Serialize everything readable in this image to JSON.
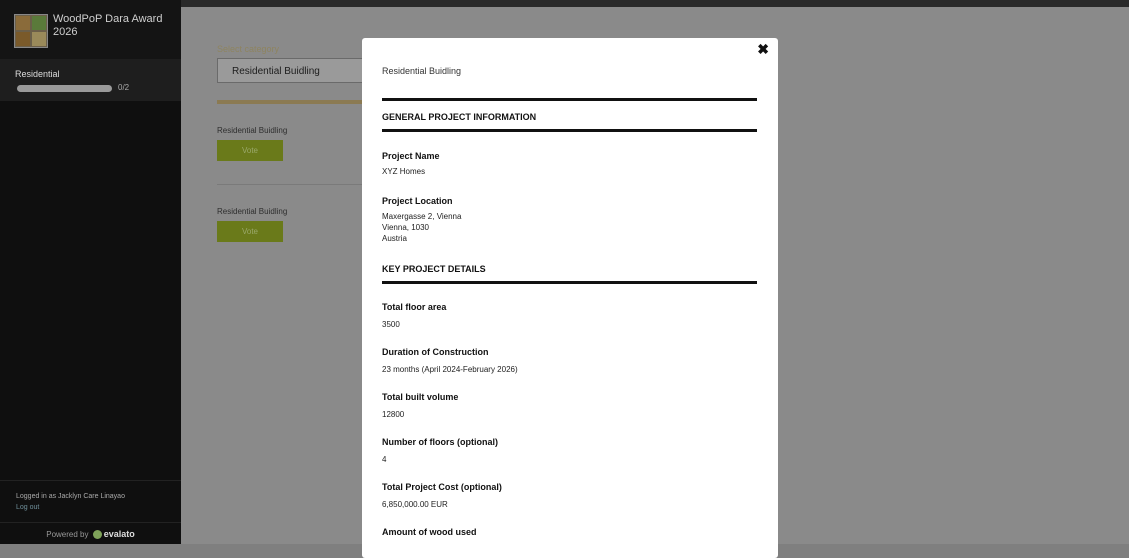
{
  "sidebar": {
    "app_title": "WoodPoP Dara Award 2026",
    "category": "Residential",
    "progress_fraction": 0.0,
    "progress_text": "0/2",
    "logged_in_text": "Logged in as Jacklyn Care Linayao",
    "logout_label": "Log out",
    "powered_label": "Powered by",
    "brand": "evalato"
  },
  "main": {
    "select_label": "Select category",
    "selected_category": "Residential Buidling",
    "entries": [
      {
        "label": "Residential Buidling",
        "vote_label": "Vote"
      },
      {
        "label": "Residential Buidling",
        "vote_label": "Vote"
      }
    ]
  },
  "modal": {
    "subtitle": "Residential Buidling",
    "close_glyph": "✖",
    "section_general": "GENERAL PROJECT INFORMATION",
    "project_name_label": "Project Name",
    "project_name_value": "XYZ Homes",
    "project_location_label": "Project Location",
    "project_location_line1": "Maxergasse 2, Vienna",
    "project_location_line2": "Vienna, 1030",
    "project_location_line3": "Austria",
    "section_key": "KEY PROJECT DETAILS",
    "floor_area_label": "Total floor area",
    "floor_area_value": "3500",
    "duration_label": "Duration of Construction",
    "duration_value": "23 months (April 2024-February 2026)",
    "volume_label": "Total built volume",
    "volume_value": "12800",
    "floors_label": "Number of floors (optional)",
    "floors_value": "4",
    "cost_label": "Total Project Cost (optional)",
    "cost_value": "6,850,000.00 EUR",
    "wood_label": "Amount of wood used"
  },
  "colors": {
    "sidebar_bg": "#0f0f0f",
    "overlay_bg": "#8a8a8a",
    "vote_green": "#6a7a1a",
    "accent_tan": "#8b7a52"
  }
}
